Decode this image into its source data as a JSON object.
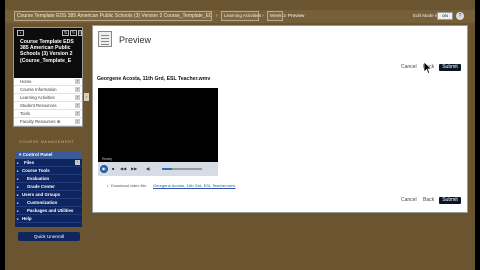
{
  "breadcrumb": {
    "course_path": "Course Template EDS 385 American Public Schools (3) Version 2 Course_Template_EDS38_3",
    "separator": "›",
    "learning_activities": "Learning Activities",
    "week": "Week 1",
    "current": "Preview"
  },
  "header": {
    "edit_mode_label": "Edit Mode is:",
    "edit_mode_value": "ON",
    "help_glyph": "?"
  },
  "course_menu": {
    "icons": [
      "+",
      "⇅",
      "↻",
      "≡"
    ],
    "title": "Course Template EDS 385 American Public Schools (3) Version 2 (Course_Template_E",
    "chevron_glyph": "›",
    "links": [
      "Home",
      "Course Information",
      "Learning Activities",
      "Student Resources",
      "Tools",
      "Faculty Resources ⊕"
    ]
  },
  "collapse_glyph": "‹",
  "course_management": {
    "heading": "COURSE MANAGEMENT",
    "control_panel": "▾ Control Panel",
    "tri_glyph": "▸",
    "items": [
      "Files",
      "Course Tools",
      "Evaluation",
      "Grade Center",
      "Users and Groups",
      "Customization",
      "Packages and Utilities",
      "Help"
    ],
    "quick_unenroll": "Quick Unenroll"
  },
  "main": {
    "title": "Preview",
    "cancel": "Cancel",
    "back": "Back",
    "submit": "Submit",
    "file_heading": "Georgene Acosta, 11th Grd, ESL Teacher.wmv",
    "ready": "Ready",
    "play_glyph": "▶",
    "ctl_glyphs": [
      "■",
      "◀◀",
      "▶▶",
      "◀)"
    ],
    "progress": 0.25,
    "bullet": "•",
    "download_label": "Download video file:",
    "download_link": "Georgene Acosta, 11th Grd, ESL Teacher.wmv"
  }
}
